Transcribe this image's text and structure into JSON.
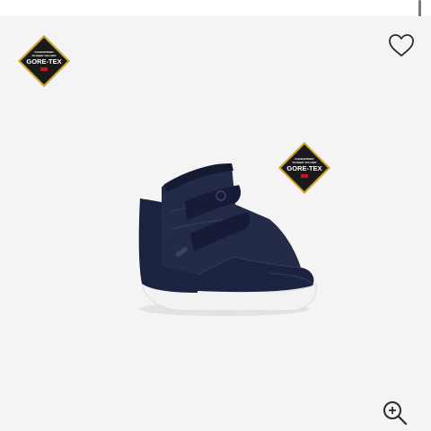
{
  "gallery": {
    "badge_top_left": {
      "brand": "GORE-TEX",
      "tagline_line1": "GUARANTEED",
      "tagline_line2": "TO KEEP YOU DRY",
      "icon": "gore-tex-badge-icon"
    },
    "badge_product": {
      "brand": "GORE-TEX",
      "tagline_line1": "GUARANTEED",
      "tagline_line2": "TO KEEP YOU DRY",
      "icon": "gore-tex-badge-icon"
    },
    "favorite_icon": "heart-outline-icon",
    "zoom_icon": "zoom-in-icon",
    "product_image_icon": "kids-winter-boot-image"
  },
  "colors": {
    "gallery_background": "#f5f4f4",
    "badge_fill": "#1a1a1a",
    "badge_gold": "#c9a227",
    "boot_navy": "#1c2340",
    "sole_white": "#f4f4f4",
    "icon_dark": "#2b2b2b"
  }
}
